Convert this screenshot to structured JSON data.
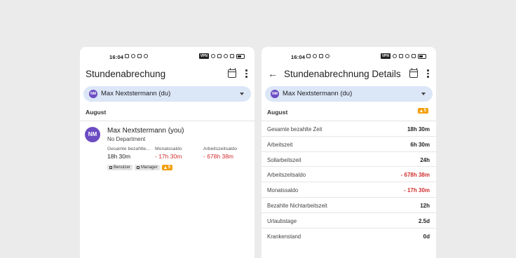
{
  "left": {
    "status": {
      "time": "16:04"
    },
    "title": "Stundenabrechung",
    "user_select": {
      "avatar": "NM",
      "name": "Max Nextstermann (du)"
    },
    "month": "August",
    "employee": {
      "avatar": "NM",
      "name": "Max Nextstermann (you)",
      "department": "No Department",
      "stats": [
        {
          "label": "Gesamte bezahlte...",
          "value": "18h 30m"
        },
        {
          "label": "Monatssaldo",
          "value": "- 17h 30m"
        },
        {
          "label": "Arbeitszeitsaldo",
          "value": "- 678h 38m"
        }
      ],
      "tags": [
        "Benutzer",
        "Manager"
      ],
      "warning_count": "5"
    }
  },
  "right": {
    "status": {
      "time": "16:04"
    },
    "title": "Stundenabrechnung Details",
    "user_select": {
      "avatar": "NM",
      "name": "Max Nextstermann (du)"
    },
    "month": "August",
    "warning_count": "5",
    "rows": [
      {
        "label": "Gesamte bezahlte Zeit",
        "value": "18h 30m"
      },
      {
        "label": "Arbeitszeit",
        "value": "6h 30m"
      },
      {
        "label": "Sollarbeitszeit",
        "value": "24h"
      },
      {
        "label": "Arbeitszeitsaldo",
        "value": "- 678h 38m"
      },
      {
        "label": "Monatssaldo",
        "value": "- 17h 30m"
      },
      {
        "label": "Bezahlte Nichtarbeitszeit",
        "value": "12h"
      },
      {
        "label": "Urlaubstage",
        "value": "2.5d"
      },
      {
        "label": "Krankenstand",
        "value": "0d"
      }
    ]
  },
  "colors": {
    "accent": "#6b4cc2",
    "selector_bg": "#dbe6f7",
    "negative": "#d32f2f",
    "warning": "#f59e0b"
  },
  "icons": [
    "calendar-icon",
    "more-vert-icon",
    "arrow-back-icon",
    "dropdown-arrow-icon",
    "warning-icon"
  ]
}
